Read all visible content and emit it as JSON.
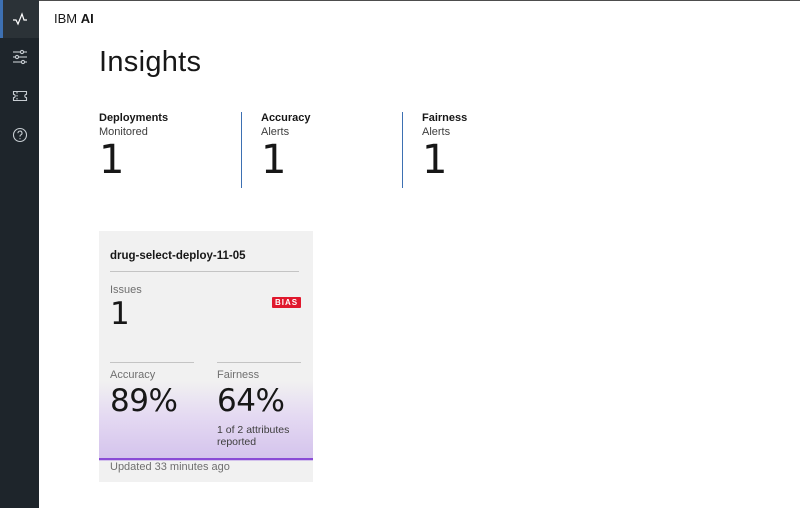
{
  "brand": {
    "prefix": "IBM",
    "name": "AI"
  },
  "nav": {
    "items": [
      {
        "icon": "activity-icon",
        "active": true
      },
      {
        "icon": "sliders-icon",
        "active": false
      },
      {
        "icon": "ticket-icon",
        "active": false
      },
      {
        "icon": "help-icon",
        "active": false
      }
    ]
  },
  "page": {
    "title": "Insights"
  },
  "stats": [
    {
      "title": "Deployments",
      "subtitle": "Monitored",
      "value": "1"
    },
    {
      "title": "Accuracy",
      "subtitle": "Alerts",
      "value": "1"
    },
    {
      "title": "Fairness",
      "subtitle": "Alerts",
      "value": "1"
    }
  ],
  "card": {
    "name": "drug-select-deploy-11-05",
    "issues_label": "Issues",
    "issues_value": "1",
    "badge": "BIAS",
    "accuracy_label": "Accuracy",
    "accuracy_value": "89%",
    "fairness_label": "Fairness",
    "fairness_value": "64%",
    "fairness_note": "1 of 2 attributes reported",
    "updated": "Updated 33 minutes ago"
  },
  "colors": {
    "rail": "#1e252b",
    "accent_blue": "#3d70b2",
    "bias_red": "#e0182d",
    "purple": "#8a4bd6"
  }
}
